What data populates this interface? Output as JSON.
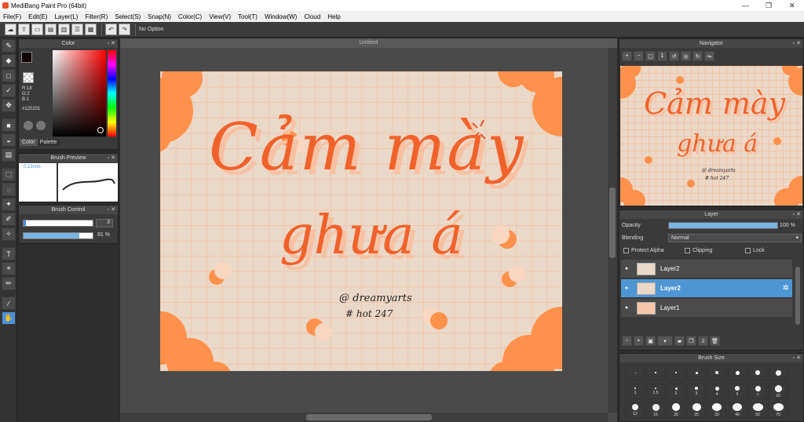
{
  "window": {
    "title": "MediBang Paint Pro (64bit)"
  },
  "menu": [
    "File(F)",
    "Edit(E)",
    "Layer(L)",
    "Filter(R)",
    "Select(S)",
    "Snap(N)",
    "Color(C)",
    "View(V)",
    "Tool(T)",
    "Window(W)",
    "Cloud",
    "Help"
  ],
  "toolbar": {
    "option": "No Option"
  },
  "color_panel": {
    "title": "Color",
    "r": "R:18",
    "g": "G:2",
    "b": "B:1",
    "hex": "#120201",
    "tabs": [
      "Color",
      "Palette"
    ],
    "fg_color": "#120201",
    "accent": "#e65c1f"
  },
  "brush_preview": {
    "title": "Brush Preview",
    "size": "0.22mm"
  },
  "brush_control": {
    "title": "Brush Control",
    "size_value": "3",
    "opacity_value": "81 %"
  },
  "canvas": {
    "tab": "Untitled"
  },
  "artwork": {
    "line1": "Cảm mày",
    "line2": "ghưa á",
    "handle": "@ dreamyarts",
    "tag": "# hot 247",
    "colors": {
      "bg": "#ead8c8",
      "grid": "#f3c3a4",
      "cloud": "#ff914d",
      "lettering": "#f0622c",
      "shadow": "#f7c1a2"
    }
  },
  "navigator": {
    "title": "Navigator"
  },
  "layer_panel": {
    "title": "Layer",
    "opacity_label": "Opacity",
    "opacity_value": "100 %",
    "blending_label": "Blending",
    "blending_value": "Normal",
    "protect_alpha": "Protect Alpha",
    "clipping": "Clipping",
    "lock": "Lock",
    "layers": [
      {
        "name": "Layer2",
        "selected": false
      },
      {
        "name": "Layer2",
        "selected": true
      },
      {
        "name": "Layer1",
        "selected": false
      }
    ]
  },
  "brush_size": {
    "title": "Brush Size",
    "row1": [
      "",
      "",
      "",
      "",
      "",
      "",
      "",
      ""
    ],
    "row2": [
      "1",
      "1.5",
      "2",
      "3",
      "4",
      "5",
      "7",
      "10"
    ],
    "row3": [
      "12",
      "15",
      "20",
      "25",
      "30",
      "40",
      "50",
      "70"
    ]
  }
}
